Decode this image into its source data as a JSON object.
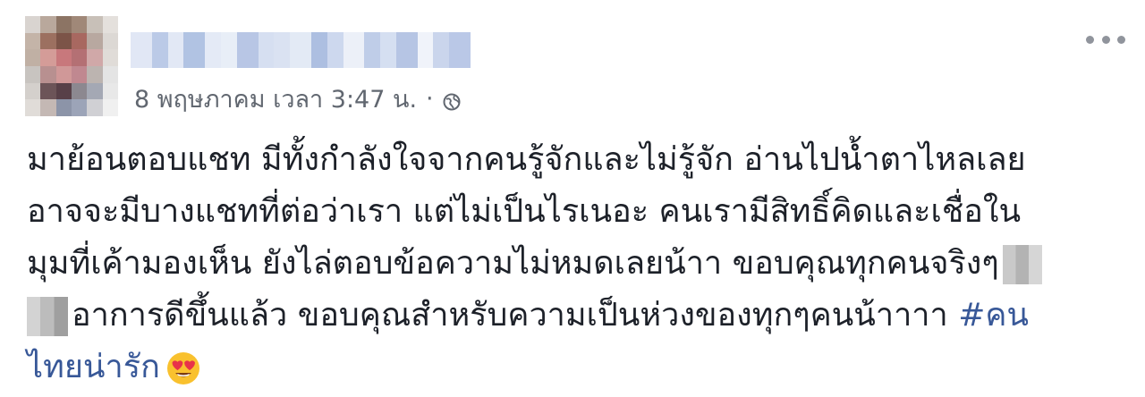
{
  "author": {
    "name_redacted": true,
    "avatar_redacted": true
  },
  "meta": {
    "timestamp": "8 พฤษภาคม เวลา 3:47 น.",
    "separator": "·",
    "privacy_icon": "globe-icon"
  },
  "post": {
    "lines": [
      "มาย้อนตอบแชท มีทั้งกำลังใจจากคนรู้จักและไม่รู้จัก อ่านไปน้ำตาไหลเลย",
      "อาจจะมีบางแชทที่ต่อว่าเรา แต่ไม่เป็นไรเนอะ คนเรามีสิทธิ์คิดและเชื่อใน",
      "มุมที่เค้ามองเห็น ยังไล่ตอบข้อความไม่หมดเลยน้าา ขอบคุณทุกคนจริงๆ",
      "อาการดีขึ้นแล้ว ขอบคุณสำหรับความเป็นห่วงของทุกๆคนน้าาาา",
      "ไทยน่ารัก"
    ],
    "hashtag_part1": "#คน",
    "emoji": "heart-eyes-emoji"
  },
  "menu": {
    "icon": "more-options-icon"
  },
  "colors": {
    "text": "#1d2129",
    "meta": "#616770",
    "hashtag": "#385898",
    "icon": "#90949c"
  }
}
